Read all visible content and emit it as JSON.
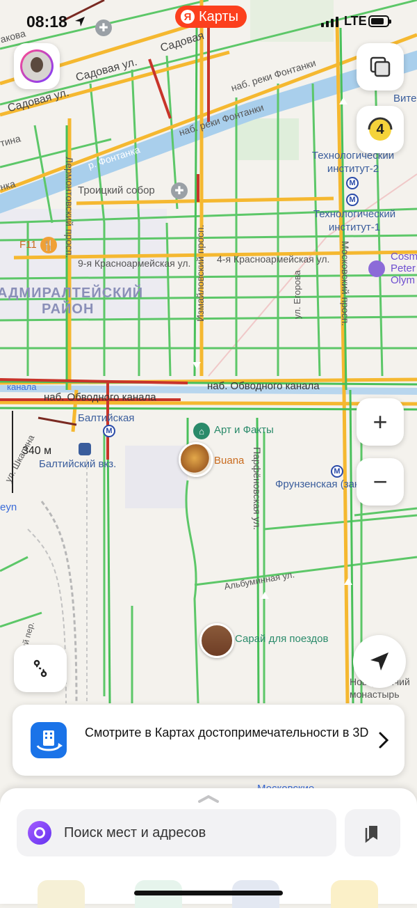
{
  "status_bar": {
    "time": "08:18",
    "network": "LTE"
  },
  "brand": {
    "badge_letter": "Я",
    "label": "Карты"
  },
  "map": {
    "streets": [
      {
        "key": "sadovaya_1",
        "text": "Садовая ул."
      },
      {
        "key": "sadovaya_2",
        "text": "Садовая ул."
      },
      {
        "key": "sadovaya_3",
        "text": "Садовая"
      },
      {
        "key": "fontanka_emb_1",
        "text": "наб. реки Фонтанки"
      },
      {
        "key": "fontanka_emb_2",
        "text": "наб. реки Фонтанки"
      },
      {
        "key": "fontanka_river",
        "text": "р. Фонтанка"
      },
      {
        "key": "lermontovsky",
        "text": "Лермонтовский просп."
      },
      {
        "key": "izmaylovsky",
        "text": "Измайловский просп."
      },
      {
        "key": "moskovsky",
        "text": "Московский просп."
      },
      {
        "key": "krasnoarm9",
        "text": "9-я Красноармейская ул."
      },
      {
        "key": "krasnoarm4",
        "text": "4-я Красноармейская ул."
      },
      {
        "key": "egorova",
        "text": "ул. Егорова"
      },
      {
        "key": "obvodny_1",
        "text": "наб. Обводного канала"
      },
      {
        "key": "obvodny_2",
        "text": "наб. Обводного канала"
      },
      {
        "key": "obvodny_left",
        "text": "канала"
      },
      {
        "key": "parfenovskaya",
        "text": "Парфёновская ул."
      },
      {
        "key": "albuminnaya",
        "text": "Альбуминная ул."
      },
      {
        "key": "shkapina",
        "text": "ул. Шкапина"
      },
      {
        "key": "edge_nakova",
        "text": "акова"
      },
      {
        "key": "edge_tina",
        "text": "тина"
      },
      {
        "key": "edge_nka",
        "text": "нка"
      },
      {
        "key": "edge_per",
        "text": "ловский пер."
      }
    ],
    "district": {
      "line1": "АДМИРАЛТЕЙСКИЙ",
      "line2": "РАЙОН"
    },
    "pois": {
      "troitsky": "Троицкий собор",
      "tech2": "Технологический институт-2",
      "tech1": "Технологический институт-1",
      "f11": "F11",
      "cosmos": "Cosm Peter Olym",
      "baltiyskaya": "Балтийская",
      "balt_station": "Балтийский вкз.",
      "art_facts": "Арт и Факты",
      "buana": "Buana",
      "frunzenskaya": "Фрунзенская (закрыто)",
      "saray": "Сарай для поездов",
      "novodevichy": "Новодевичий монастырь",
      "vite": "Вите",
      "moskovskie": "Московские",
      "eyn": "eyn"
    },
    "traffic_score": "4",
    "scale_label": "340 м"
  },
  "controls": {
    "zoom_in": "+",
    "zoom_out": "−"
  },
  "banner": {
    "text": "Смотрите в Картах достопримечательности в 3D"
  },
  "search": {
    "placeholder": "Поиск мест и адресов"
  },
  "colors": {
    "accent": "#fc3f1d",
    "traffic_green": "#49c05a",
    "traffic_yellow": "#f5b830",
    "traffic_red": "#c8342a"
  }
}
